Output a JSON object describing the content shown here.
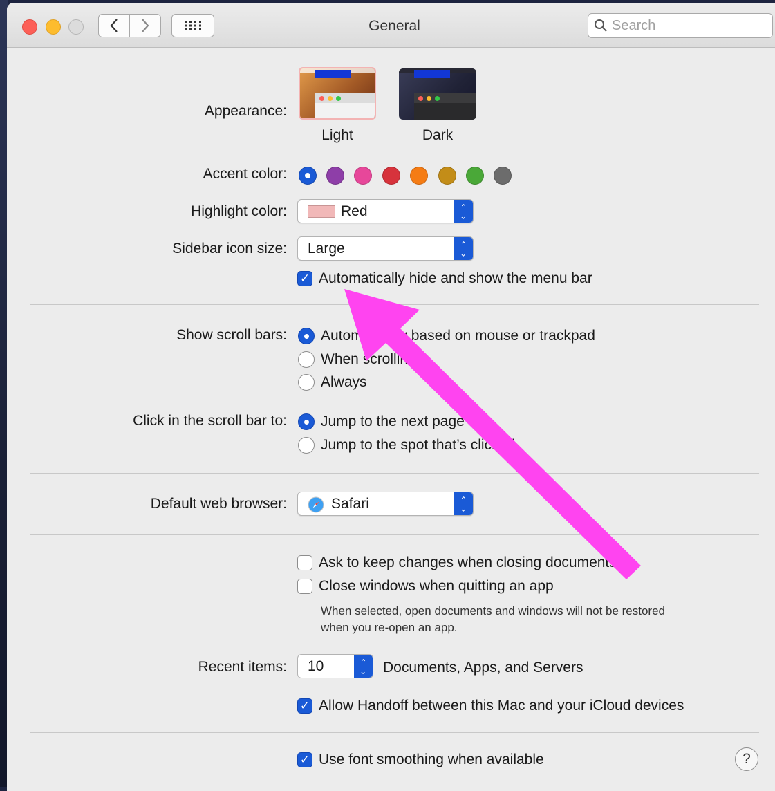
{
  "window": {
    "title": "General"
  },
  "toolbar": {
    "search_placeholder": "Search"
  },
  "appearance": {
    "label": "Appearance:",
    "options": [
      "Light",
      "Dark"
    ],
    "selected": "Light"
  },
  "accent": {
    "label": "Accent color:",
    "colors": [
      "#1a5ad6",
      "#8e3ea8",
      "#e7479a",
      "#d7333c",
      "#f57c14",
      "#c38d18",
      "#4aa838",
      "#6c6c6c"
    ],
    "selected_index": 0
  },
  "highlight": {
    "label": "Highlight color:",
    "value": "Red",
    "swatch": "#f1b8b8"
  },
  "sidebar_icon": {
    "label": "Sidebar icon size:",
    "value": "Large"
  },
  "menu_bar": {
    "label": "Automatically hide and show the menu bar",
    "checked": true
  },
  "scroll_bars": {
    "label": "Show scroll bars:",
    "options": [
      "Automatically based on mouse or trackpad",
      "When scrolling",
      "Always"
    ],
    "selected_index": 0
  },
  "click_scroll": {
    "label": "Click in the scroll bar to:",
    "options": [
      "Jump to the next page",
      "Jump to the spot that’s clicked"
    ],
    "selected_index": 0
  },
  "browser": {
    "label": "Default web browser:",
    "value": "Safari"
  },
  "documents": {
    "ask_keep": {
      "label": "Ask to keep changes when closing documents",
      "checked": false
    },
    "close_windows": {
      "label": "Close windows when quitting an app",
      "checked": false
    },
    "note_line1": "When selected, open documents and windows will not be restored",
    "note_line2": "when you re-open an app."
  },
  "recent": {
    "label": "Recent items:",
    "value": "10",
    "suffix": "Documents, Apps, and Servers"
  },
  "handoff": {
    "label": "Allow Handoff between this Mac and your iCloud devices",
    "checked": true
  },
  "font_smoothing": {
    "label": "Use font smoothing when available",
    "checked": true
  },
  "help": {
    "glyph": "?"
  },
  "annotation": {
    "color": "#ff44f0"
  }
}
